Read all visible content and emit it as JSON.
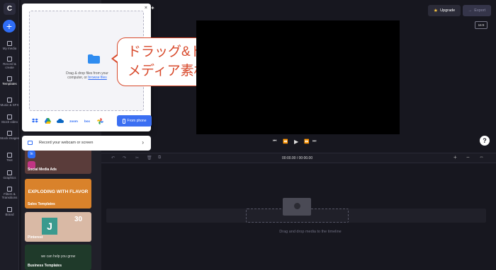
{
  "app": {
    "logo": "C"
  },
  "rail": {
    "add_label": "+",
    "items": [
      {
        "label": "My media",
        "icon": "folder-icon"
      },
      {
        "label": "Record & create",
        "icon": "camera-icon"
      },
      {
        "label": "Templates",
        "icon": "templates-icon"
      },
      {
        "label": "Music & SFX",
        "icon": "music-icon"
      },
      {
        "label": "Stock video",
        "icon": "film-icon"
      },
      {
        "label": "Stock images",
        "icon": "image-icon"
      },
      {
        "label": "Text",
        "icon": "text-icon"
      },
      {
        "label": "Graphics",
        "icon": "shapes-icon"
      },
      {
        "label": "Filters & Transitions",
        "icon": "transitions-icon"
      },
      {
        "label": "Brand",
        "icon": "brand-icon"
      }
    ]
  },
  "templates": [
    {
      "label": "Social Media Ads",
      "color": "#5a3c3a"
    },
    {
      "label": "Sales Templates",
      "color": "#d9822b"
    },
    {
      "label": "Pinterest",
      "color": "#d9b9a5"
    },
    {
      "label": "Business Templates",
      "color": "#1f3a2a"
    }
  ],
  "template_overlay": {
    "instagram_letters": "In",
    "sales_headline": "EXPLODING WITH FLAVOR",
    "pinterest_number": "30",
    "pinterest_letter": "J",
    "business_caption": "we can help you grow"
  },
  "upload": {
    "close": "×",
    "drop_text_1": "Drag & drop files from your",
    "drop_text_2": "computer, or ",
    "browse_link": "browse files",
    "sources": [
      "dropbox",
      "google-drive",
      "onedrive",
      "zoom",
      "box",
      "google-photos"
    ],
    "zoom_label": "zoom",
    "box_label": "box",
    "from_phone": "From phone",
    "webcam_label": "Record your webcam or screen",
    "webcam_arrow": "›"
  },
  "callout": {
    "line1": "ドラッグ&ドロップで",
    "line2": "メディア素材をインポート",
    "color": "#d84a2c"
  },
  "topbar": {
    "upgrade": "Upgrade",
    "export": "Export",
    "export_arrow": "→",
    "aspect_ratio": "16:9"
  },
  "player": {
    "prev": "⏮",
    "rewind": "⏪",
    "play": "▶",
    "forward": "⏩",
    "next": "⏭",
    "help": "?"
  },
  "timeline": {
    "time": "00:00.00 / 00:00.00",
    "drop_hint": "Drag and drop media to the timeline",
    "undo": "↶",
    "redo": "↷",
    "cut": "✂",
    "delete": "🗑",
    "copy": "⧉",
    "zoom_in": "+",
    "zoom_out": "−",
    "fit": "⇔"
  },
  "colors": {
    "accent": "#2f6df6",
    "background": "#17171f",
    "panel": "#202029"
  }
}
